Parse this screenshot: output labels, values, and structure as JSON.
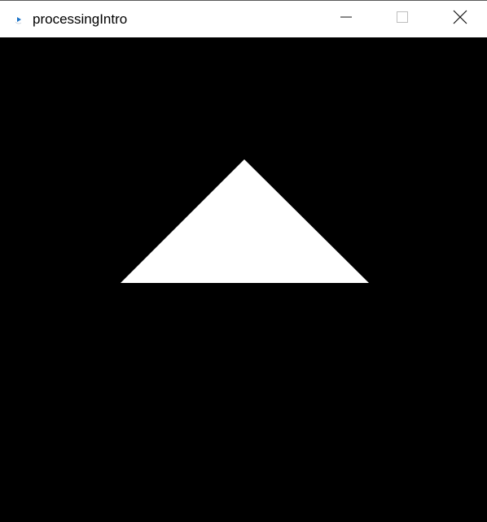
{
  "window": {
    "title": "processingIntro"
  },
  "titlebar": {
    "icons": {
      "app": "processing-app-icon",
      "minimize": "minimize-icon",
      "maximize": "maximize-icon",
      "close": "close-icon"
    }
  },
  "sketch": {
    "background_color": "#000000",
    "shape": "triangle",
    "fill_color": "#ffffff"
  },
  "colors": {
    "titlebar_bg": "#ffffff",
    "title_text": "#000000",
    "icon_accent": "#1a73c8",
    "caption_glyph": "#111111",
    "maximize_disabled": "#bdbdbd"
  }
}
